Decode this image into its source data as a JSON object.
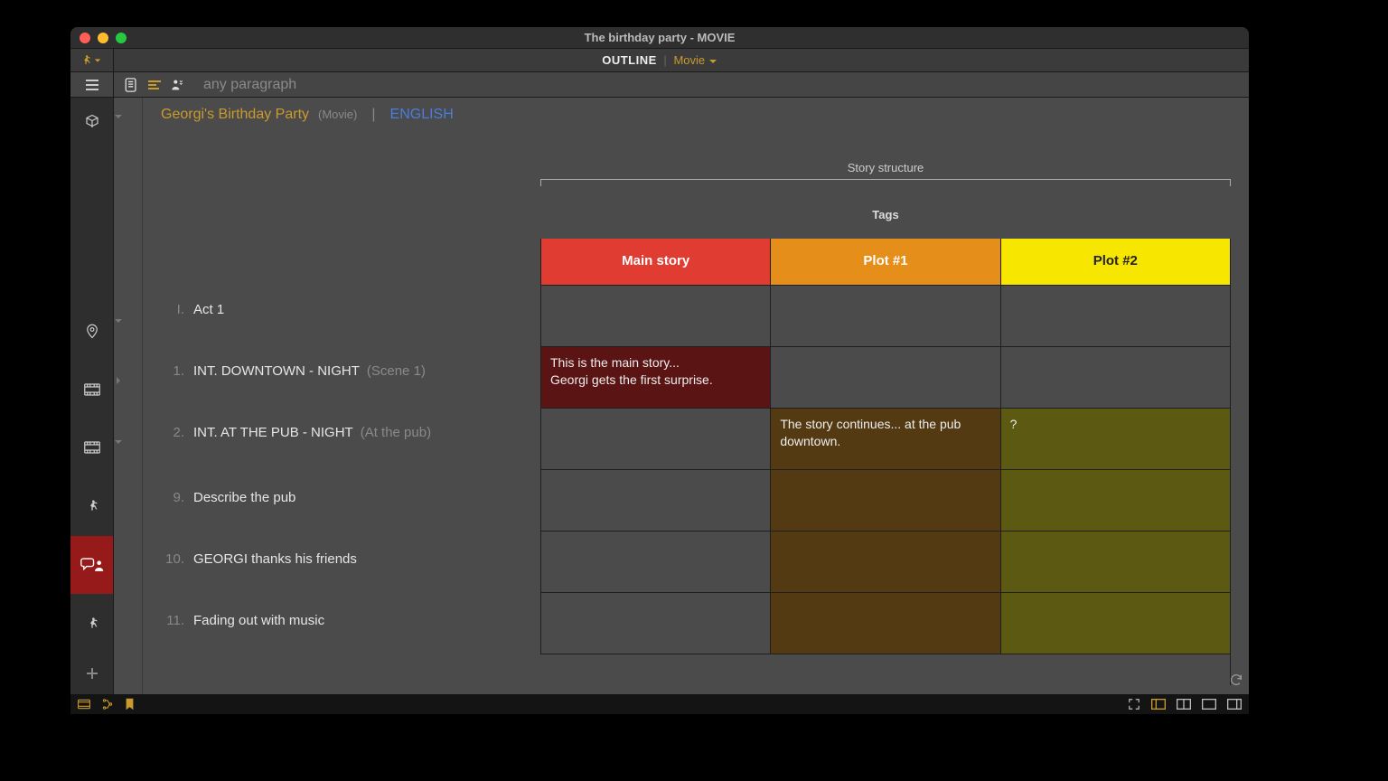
{
  "window": {
    "title": "The birthday party - MOVIE"
  },
  "toolbar1": {
    "outline_label": "OUTLINE",
    "mode_label": "Movie"
  },
  "toolbar2": {
    "placeholder": "any paragraph"
  },
  "header": {
    "project_name": "Georgi's Birthday Party",
    "project_type": "(Movie)",
    "separator": "|",
    "language": "ENGLISH"
  },
  "structure": {
    "label": "Story structure"
  },
  "tags": {
    "label": "Tags",
    "columns": [
      "Main story",
      "Plot #1",
      "Plot #2"
    ]
  },
  "outline": {
    "rows": [
      {
        "num": "I.",
        "label": "Act 1",
        "hint": "",
        "kind": "act"
      },
      {
        "num": "1.",
        "label": "INT.  DOWNTOWN - NIGHT",
        "hint": "(Scene 1)",
        "kind": "scene"
      },
      {
        "num": "2.",
        "label": "INT.  AT THE PUB - NIGHT",
        "hint": "(At the pub)",
        "kind": "scene"
      },
      {
        "num": "9.",
        "label": "Describe the pub",
        "hint": "",
        "kind": "line"
      },
      {
        "num": "10.",
        "label": "GEORGI thanks his friends",
        "hint": "",
        "kind": "line"
      },
      {
        "num": "11.",
        "label": "Fading out with music",
        "hint": "",
        "kind": "line"
      }
    ]
  },
  "grid": {
    "cells": [
      [
        "",
        "",
        ""
      ],
      [
        "This is the main story...\nGeorgi gets the first surprise.",
        "",
        ""
      ],
      [
        "",
        "The story continues... at the pub downtown.",
        "?"
      ],
      [
        "",
        "",
        ""
      ],
      [
        "",
        "",
        ""
      ],
      [
        "",
        "",
        ""
      ]
    ],
    "bg": [
      [
        "",
        "",
        ""
      ],
      [
        "main",
        "",
        ""
      ],
      [
        "",
        "p1",
        "p2"
      ],
      [
        "",
        "p1",
        "p2"
      ],
      [
        "",
        "p1",
        "p2"
      ],
      [
        "",
        "p1",
        "p2"
      ]
    ]
  }
}
